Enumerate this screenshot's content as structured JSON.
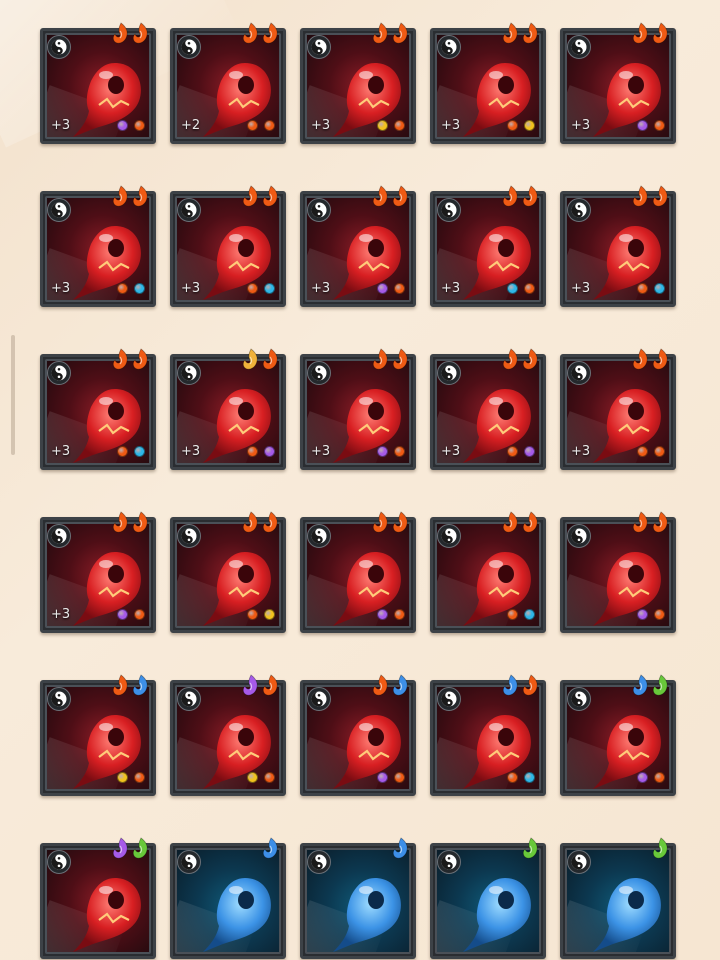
{
  "palette": {
    "orange": "#ef5a14",
    "purple": "#a65ae8",
    "yellow": "#f2c21e",
    "cyan": "#2eb7e8",
    "blue": "#3d8fe8",
    "green": "#68c83a",
    "gold": "#f0b23a"
  },
  "cards": [
    {
      "type": "red",
      "flames": [
        "orange",
        "orange"
      ],
      "level": "+3",
      "dots": [
        "purple",
        "orange"
      ]
    },
    {
      "type": "red",
      "flames": [
        "orange",
        "orange"
      ],
      "level": "+2",
      "dots": [
        "orange",
        "orange"
      ]
    },
    {
      "type": "red",
      "flames": [
        "orange",
        "orange"
      ],
      "level": "+3",
      "dots": [
        "yellow",
        "orange"
      ]
    },
    {
      "type": "red",
      "flames": [
        "orange",
        "orange"
      ],
      "level": "+3",
      "dots": [
        "orange",
        "yellow"
      ]
    },
    {
      "type": "red",
      "flames": [
        "orange",
        "orange"
      ],
      "level": "+3",
      "dots": [
        "purple",
        "orange"
      ]
    },
    {
      "type": "red",
      "flames": [
        "orange",
        "orange"
      ],
      "level": "+3",
      "dots": [
        "orange",
        "cyan"
      ]
    },
    {
      "type": "red",
      "flames": [
        "orange",
        "orange"
      ],
      "level": "+3",
      "dots": [
        "orange",
        "cyan"
      ]
    },
    {
      "type": "red",
      "flames": [
        "orange",
        "orange"
      ],
      "level": "+3",
      "dots": [
        "purple",
        "orange"
      ]
    },
    {
      "type": "red",
      "flames": [
        "orange",
        "orange"
      ],
      "level": "+3",
      "dots": [
        "cyan",
        "orange"
      ]
    },
    {
      "type": "red",
      "flames": [
        "orange",
        "orange"
      ],
      "level": "+3",
      "dots": [
        "orange",
        "cyan"
      ]
    },
    {
      "type": "red",
      "flames": [
        "orange",
        "orange"
      ],
      "level": "+3",
      "dots": [
        "orange",
        "cyan"
      ]
    },
    {
      "type": "red",
      "flames": [
        "gold",
        "orange"
      ],
      "level": "+3",
      "dots": [
        "orange",
        "purple"
      ]
    },
    {
      "type": "red",
      "flames": [
        "orange",
        "orange"
      ],
      "level": "+3",
      "dots": [
        "purple",
        "orange"
      ]
    },
    {
      "type": "red",
      "flames": [
        "orange",
        "orange"
      ],
      "level": "+3",
      "dots": [
        "orange",
        "purple"
      ]
    },
    {
      "type": "red",
      "flames": [
        "orange",
        "orange"
      ],
      "level": "+3",
      "dots": [
        "orange",
        "orange"
      ]
    },
    {
      "type": "red",
      "flames": [
        "orange",
        "orange"
      ],
      "level": "+3",
      "dots": [
        "purple",
        "orange"
      ]
    },
    {
      "type": "red",
      "flames": [
        "orange",
        "orange"
      ],
      "level": "",
      "dots": [
        "orange",
        "yellow"
      ]
    },
    {
      "type": "red",
      "flames": [
        "orange",
        "orange"
      ],
      "level": "",
      "dots": [
        "purple",
        "orange"
      ]
    },
    {
      "type": "red",
      "flames": [
        "orange",
        "orange"
      ],
      "level": "",
      "dots": [
        "orange",
        "cyan"
      ]
    },
    {
      "type": "red",
      "flames": [
        "orange",
        "orange"
      ],
      "level": "",
      "dots": [
        "purple",
        "orange"
      ]
    },
    {
      "type": "red",
      "flames": [
        "orange",
        "blue"
      ],
      "level": "",
      "dots": [
        "yellow",
        "orange"
      ]
    },
    {
      "type": "red",
      "flames": [
        "purple",
        "orange"
      ],
      "level": "",
      "dots": [
        "yellow",
        "orange"
      ]
    },
    {
      "type": "red",
      "flames": [
        "orange",
        "blue"
      ],
      "level": "",
      "dots": [
        "purple",
        "orange"
      ]
    },
    {
      "type": "red",
      "flames": [
        "blue",
        "orange"
      ],
      "level": "",
      "dots": [
        "orange",
        "cyan"
      ]
    },
    {
      "type": "red",
      "flames": [
        "blue",
        "green"
      ],
      "level": "",
      "dots": [
        "purple",
        "orange"
      ]
    },
    {
      "type": "red",
      "flames": [
        "purple",
        "green"
      ],
      "level": "",
      "dots": []
    },
    {
      "type": "blue",
      "flames": [
        "blue"
      ],
      "level": "",
      "dots": []
    },
    {
      "type": "blue",
      "flames": [
        "blue"
      ],
      "level": "",
      "dots": []
    },
    {
      "type": "blue",
      "flames": [
        "green"
      ],
      "level": "",
      "dots": []
    },
    {
      "type": "blue",
      "flames": [
        "green"
      ],
      "level": "",
      "dots": []
    }
  ]
}
